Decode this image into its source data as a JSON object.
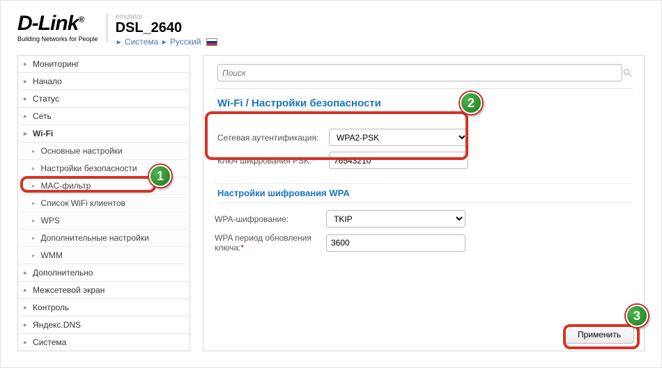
{
  "header": {
    "logo_text": "D-Link",
    "logo_subtitle": "Building Networks for People",
    "emulator_label": "emulator",
    "model": "DSL_2640",
    "crumb_system": "Система",
    "crumb_language": "Русский"
  },
  "sidebar": {
    "items": [
      {
        "label": "Мониторинг",
        "sub": []
      },
      {
        "label": "Начало",
        "sub": []
      },
      {
        "label": "Статус",
        "sub": []
      },
      {
        "label": "Сеть",
        "sub": []
      },
      {
        "label": "Wi-Fi",
        "active": true,
        "sub": [
          {
            "label": "Основные настройки"
          },
          {
            "label": "Настройки безопасности",
            "active": true
          },
          {
            "label": "MAC-фильтр"
          },
          {
            "label": "Список WiFi клиентов"
          },
          {
            "label": "WPS"
          },
          {
            "label": "Дополнительные настройки"
          },
          {
            "label": "WMM"
          }
        ]
      },
      {
        "label": "Дополнительно",
        "sub": []
      },
      {
        "label": "Межсетевой экран",
        "sub": []
      },
      {
        "label": "Контроль",
        "sub": []
      },
      {
        "label": "Яндекс.DNS",
        "sub": []
      },
      {
        "label": "Система",
        "sub": []
      }
    ]
  },
  "content": {
    "search_placeholder": "Поиск",
    "title": "Wi-Fi /  Настройки безопасности",
    "auth_label": "Сетевая аутентификация:",
    "auth_value": "WPA2-PSK",
    "psk_label": "Ключ шифрования PSK:",
    "psk_value": "76543210",
    "wpa_section_title": "Настройки шифрования WPA",
    "wpa_enc_label": "WPA-шифрование:",
    "wpa_enc_value": "TKIP",
    "wpa_rekey_label": "WPA период обновления ключа:",
    "wpa_rekey_value": "3600",
    "apply_label": "Применить"
  },
  "callouts": {
    "c1": "1",
    "c2": "2",
    "c3": "3"
  }
}
